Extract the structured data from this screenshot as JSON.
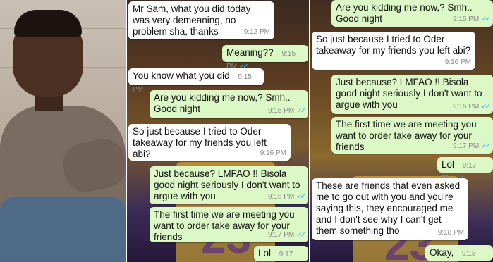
{
  "left_chat": {
    "messages": [
      {
        "dir": "in",
        "text": "Mr Sam, what you did today was very demeaning, no problem sha, thanks",
        "time": "9:12 PM",
        "ticks": ""
      },
      {
        "dir": "out",
        "text": "Meaning??",
        "time": "9:15 PM",
        "ticks": "✓✓"
      },
      {
        "dir": "in",
        "text": "You know what you did",
        "time": "9:15 PM",
        "ticks": ""
      },
      {
        "dir": "out",
        "text": "Are you kidding me now,? Smh.. Good night",
        "time": "9:15 PM",
        "ticks": "✓✓"
      },
      {
        "dir": "in",
        "text": "So just because I tried to Oder takeaway for my friends you left abi?",
        "time": "9:16 PM",
        "ticks": ""
      },
      {
        "dir": "out",
        "text": "Just because?  LMFAO !! Bisola good night  seriously I don't want to argue with you",
        "time": "9:16 PM",
        "ticks": "✓✓"
      },
      {
        "dir": "out",
        "text": "The first time we are meeting you want to order take away for your friends",
        "time": "9:17 PM",
        "ticks": "✓✓"
      },
      {
        "dir": "out",
        "text": "Lol",
        "time": "9:17 PM",
        "ticks": "✓✓"
      }
    ]
  },
  "right_chat": {
    "messages": [
      {
        "dir": "out",
        "text": "Are you kidding me now,? Smh.. Good night",
        "time": "9:15 PM",
        "ticks": "✓✓"
      },
      {
        "dir": "in",
        "text": "So just because I tried to Oder takeaway for my friends you left abi?",
        "time": "9:16 PM",
        "ticks": ""
      },
      {
        "dir": "out",
        "text": "Just because?  LMFAO !! Bisola good night  seriously I don't want to argue with you",
        "time": "9:16 PM",
        "ticks": "✓✓"
      },
      {
        "dir": "out",
        "text": "The first time we are meeting you want to order take away for your friends",
        "time": "9:17 PM",
        "ticks": "✓✓"
      },
      {
        "dir": "out",
        "text": "Lol",
        "time": "9:17 PM",
        "ticks": "✓✓"
      },
      {
        "dir": "in",
        "text": "These are friends that even asked me to go out with you and you're saying this, they encouraged me and I don't see why I can't get them something tho",
        "time": "9:18 PM",
        "ticks": ""
      },
      {
        "dir": "out",
        "text": "Okay,",
        "time": "9:18 PM",
        "ticks": "✓✓"
      }
    ]
  },
  "colors": {
    "incoming": "#ffffff",
    "outgoing": "#dcf8c6",
    "read_ticks": "#34b7f1",
    "timestamp": "#8a8a8a"
  }
}
